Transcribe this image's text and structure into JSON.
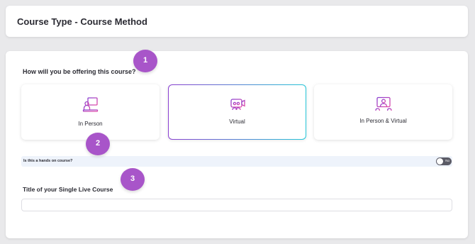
{
  "header": {
    "title": "Course Type - Course Method"
  },
  "form": {
    "question": "How will you be offering this course?",
    "options": [
      {
        "label": "In Person",
        "icon": "person-presenter-icon",
        "selected": false
      },
      {
        "label": "Virtual",
        "icon": "video-conference-icon",
        "selected": true
      },
      {
        "label": "In Person & Virtual",
        "icon": "hybrid-presenter-icon",
        "selected": false
      }
    ],
    "hands_on": {
      "label": "Is this a hands on course?",
      "toggle_text": "No",
      "value": false
    },
    "title_field": {
      "label": "Title of your Single Live Course",
      "value": "",
      "placeholder": ""
    }
  },
  "annotations": [
    "1",
    "2",
    "3"
  ],
  "colors": {
    "icon_gradient_start": "#8a3fd1",
    "icon_gradient_end": "#e24ca8",
    "selected_border_start": "#8a3fd1",
    "selected_border_end": "#25c7d9",
    "badge": "#a855c9",
    "hands_row_bg": "#eef3fb"
  }
}
